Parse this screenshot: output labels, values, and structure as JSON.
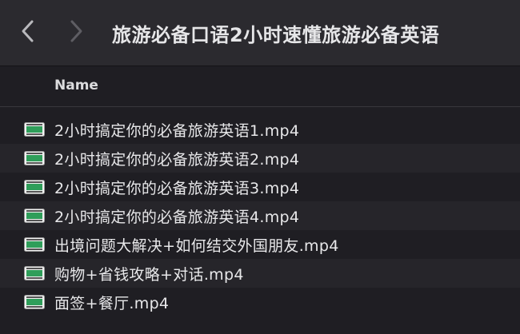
{
  "window": {
    "title": "旅游必备口语2小时速懂旅游必备英语"
  },
  "nav": {
    "back_icon": "chevron-left-icon",
    "forward_icon": "chevron-right-icon"
  },
  "columns": {
    "name": "Name"
  },
  "files": [
    {
      "name": "2小时搞定你的必备旅游英语1.mp4",
      "icon": "video-file-icon"
    },
    {
      "name": "2小时搞定你的必备旅游英语2.mp4",
      "icon": "video-file-icon"
    },
    {
      "name": "2小时搞定你的必备旅游英语3.mp4",
      "icon": "video-file-icon"
    },
    {
      "name": "2小时搞定你的必备旅游英语4.mp4",
      "icon": "video-file-icon"
    },
    {
      "name": "出境问题大解决+如何结交外国朋友.mp4",
      "icon": "video-file-icon"
    },
    {
      "name": "购物+省钱攻略+对话.mp4",
      "icon": "video-file-icon"
    },
    {
      "name": "面签+餐厅.mp4",
      "icon": "video-file-icon"
    }
  ],
  "colors": {
    "background": "#1f1e23",
    "toolbar": "#2b2a2f",
    "text": "#e8e8ea",
    "icon_green": "#2f9e5a"
  }
}
